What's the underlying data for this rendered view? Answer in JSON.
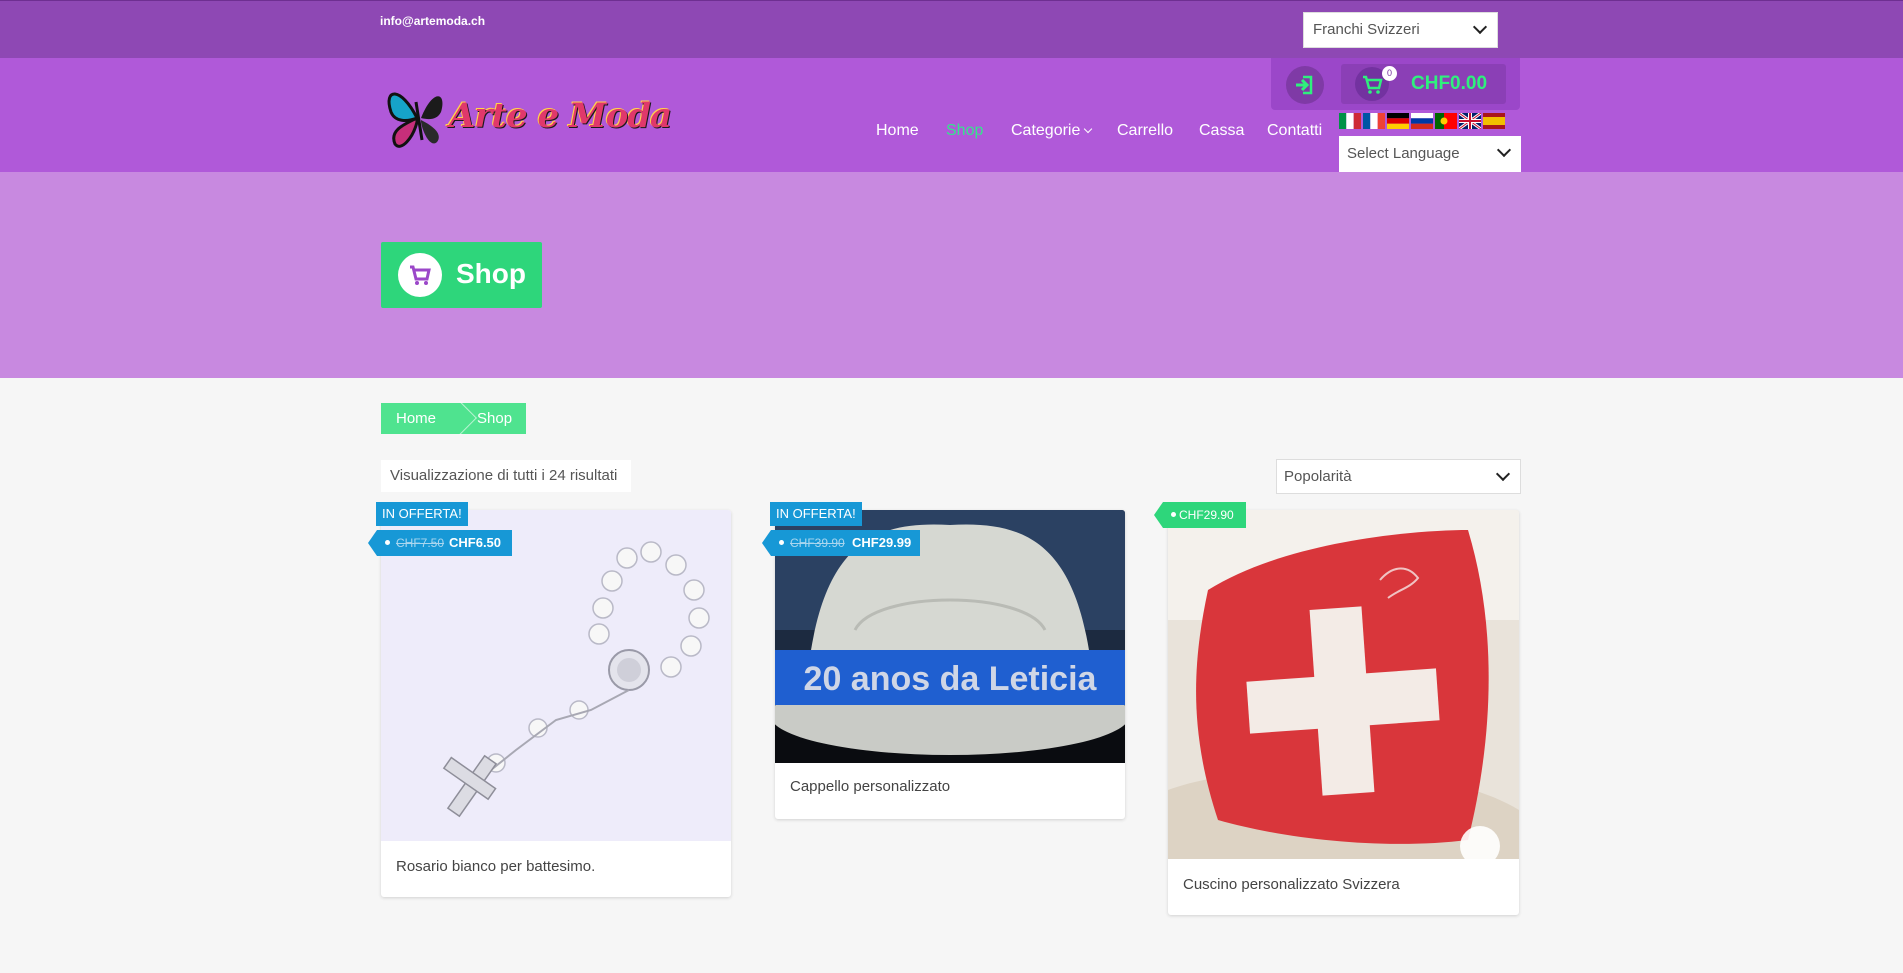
{
  "topbar": {
    "email": "info@artemoda.ch",
    "currency": "Franchi Svizzeri"
  },
  "logo": {
    "text": "Arte e Moda"
  },
  "cart": {
    "count": "0",
    "total": "CHF0.00"
  },
  "nav": {
    "items": [
      {
        "label": "Home",
        "active": false
      },
      {
        "label": "Shop",
        "active": true
      },
      {
        "label": "Categorie",
        "active": false,
        "has_dropdown": true
      },
      {
        "label": "Carrello",
        "active": false
      },
      {
        "label": "Cassa",
        "active": false
      },
      {
        "label": "Contatti",
        "active": false
      }
    ]
  },
  "language": {
    "select_label": "Select Language",
    "flags": [
      "italian",
      "french",
      "german",
      "russian",
      "portuguese",
      "english",
      "spanish"
    ]
  },
  "banner": {
    "title": "Shop",
    "icon": "shopping-cart-icon"
  },
  "breadcrumb": {
    "items": [
      "Home",
      "Shop"
    ]
  },
  "shop": {
    "result_count": "Visualizzazione di tutti i 24 risultati",
    "orderby": "Popolarità"
  },
  "products": [
    {
      "title": "Rosario bianco per battesimo.",
      "sale_label": "IN OFFERTA!",
      "old_price": "CHF7.50",
      "price": "CHF6.50"
    },
    {
      "title": "Cappello personalizzato",
      "sale_label": "IN OFFERTA!",
      "old_price": "CHF39.90",
      "price": "CHF29.99",
      "image_text": "20 anos da Leticia"
    },
    {
      "title": "Cuscino personalizzato Svizzera",
      "price": "CHF29.90"
    }
  ],
  "colors": {
    "topbar": "#8e48b4",
    "header": "#b059d9",
    "banner": "#c889e0",
    "accent_green": "#2ed67b",
    "sale_blue": "#1798d6"
  }
}
